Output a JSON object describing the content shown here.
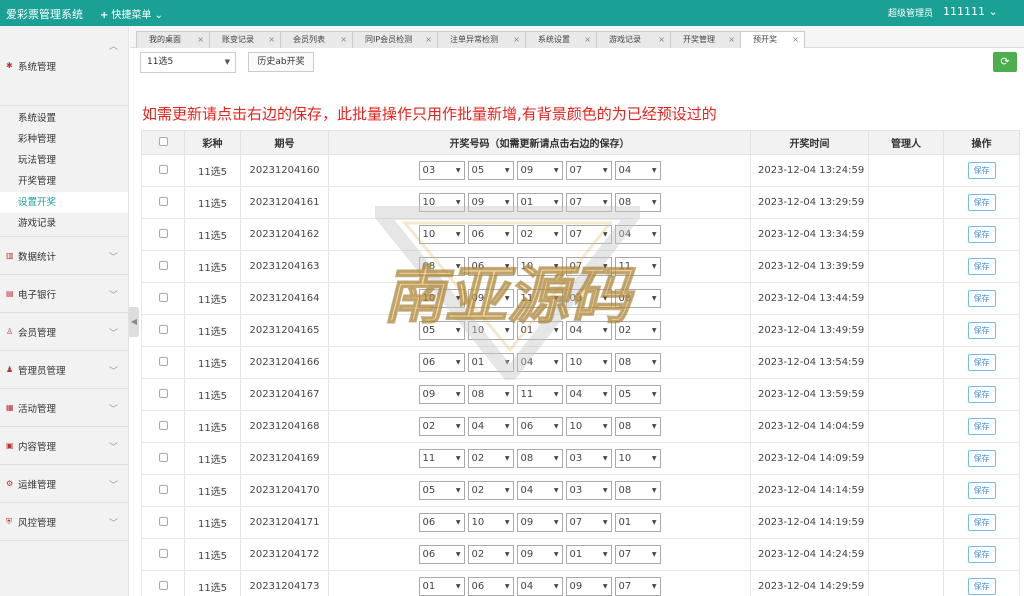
{
  "topbar": {
    "brand": "爱彩票管理系统",
    "quick_menu": "快捷菜单",
    "admin_role": "超级管理员",
    "username": "111111"
  },
  "sidebar": {
    "sections": [
      {
        "label": "系统管理",
        "icon": "gear-icon",
        "items": [
          {
            "label": "系统设置"
          },
          {
            "label": "彩种管理"
          },
          {
            "label": "玩法管理"
          },
          {
            "label": "开奖管理"
          },
          {
            "label": "设置开奖"
          },
          {
            "label": "游戏记录"
          }
        ]
      },
      {
        "label": "数据统计",
        "icon": "chart-icon"
      },
      {
        "label": "电子银行",
        "icon": "bank-icon"
      },
      {
        "label": "会员管理",
        "icon": "user-icon"
      },
      {
        "label": "管理员管理",
        "icon": "admin-icon"
      },
      {
        "label": "活动管理",
        "icon": "calendar-icon"
      },
      {
        "label": "内容管理",
        "icon": "content-icon"
      },
      {
        "label": "运维管理",
        "icon": "tools-icon"
      },
      {
        "label": "风控管理",
        "icon": "shield-icon"
      }
    ]
  },
  "tabs": [
    "我的桌面",
    "账变记录",
    "会员列表",
    "同IP会员检测",
    "注单异常检测",
    "系统设置",
    "游戏记录",
    "开奖管理",
    "预开奖"
  ],
  "toolbar": {
    "lottery_select": "11选5",
    "history_button": "历史ab开奖"
  },
  "notice": "如需更新请点击右边的保存，此批量操作只用作批量新增,有背景颜色的为已经预设过的",
  "table": {
    "headers": {
      "lottery": "彩种",
      "period": "期号",
      "numbers": "开奖号码（如需更新请点击右边的保存）",
      "time": "开奖时间",
      "manager": "管理人",
      "action": "操作"
    },
    "save_label": "保存",
    "rows": [
      {
        "lottery": "11选5",
        "period": "20231204160",
        "nums": [
          "03",
          "05",
          "09",
          "07",
          "04"
        ],
        "time": "2023-12-04 13:24:59"
      },
      {
        "lottery": "11选5",
        "period": "20231204161",
        "nums": [
          "10",
          "09",
          "01",
          "07",
          "08"
        ],
        "time": "2023-12-04 13:29:59"
      },
      {
        "lottery": "11选5",
        "period": "20231204162",
        "nums": [
          "10",
          "06",
          "02",
          "07",
          "04"
        ],
        "time": "2023-12-04 13:34:59"
      },
      {
        "lottery": "11选5",
        "period": "20231204163",
        "nums": [
          "08",
          "06",
          "10",
          "07",
          "11"
        ],
        "time": "2023-12-04 13:39:59"
      },
      {
        "lottery": "11选5",
        "period": "20231204164",
        "nums": [
          "10",
          "09",
          "11",
          "03",
          "08"
        ],
        "time": "2023-12-04 13:44:59"
      },
      {
        "lottery": "11选5",
        "period": "20231204165",
        "nums": [
          "05",
          "10",
          "01",
          "04",
          "02"
        ],
        "time": "2023-12-04 13:49:59"
      },
      {
        "lottery": "11选5",
        "period": "20231204166",
        "nums": [
          "06",
          "01",
          "04",
          "10",
          "08"
        ],
        "time": "2023-12-04 13:54:59"
      },
      {
        "lottery": "11选5",
        "period": "20231204167",
        "nums": [
          "09",
          "08",
          "11",
          "04",
          "05"
        ],
        "time": "2023-12-04 13:59:59"
      },
      {
        "lottery": "11选5",
        "period": "20231204168",
        "nums": [
          "02",
          "04",
          "06",
          "10",
          "08"
        ],
        "time": "2023-12-04 14:04:59"
      },
      {
        "lottery": "11选5",
        "period": "20231204169",
        "nums": [
          "11",
          "02",
          "08",
          "03",
          "10"
        ],
        "time": "2023-12-04 14:09:59"
      },
      {
        "lottery": "11选5",
        "period": "20231204170",
        "nums": [
          "05",
          "02",
          "04",
          "03",
          "08"
        ],
        "time": "2023-12-04 14:14:59"
      },
      {
        "lottery": "11选5",
        "period": "20231204171",
        "nums": [
          "06",
          "10",
          "09",
          "07",
          "01"
        ],
        "time": "2023-12-04 14:19:59"
      },
      {
        "lottery": "11选5",
        "period": "20231204172",
        "nums": [
          "06",
          "02",
          "09",
          "01",
          "07"
        ],
        "time": "2023-12-04 14:24:59"
      },
      {
        "lottery": "11选5",
        "period": "20231204173",
        "nums": [
          "01",
          "06",
          "04",
          "09",
          "07"
        ],
        "time": "2023-12-04 14:29:59"
      }
    ]
  },
  "watermark": {
    "text": "南亚源码"
  }
}
